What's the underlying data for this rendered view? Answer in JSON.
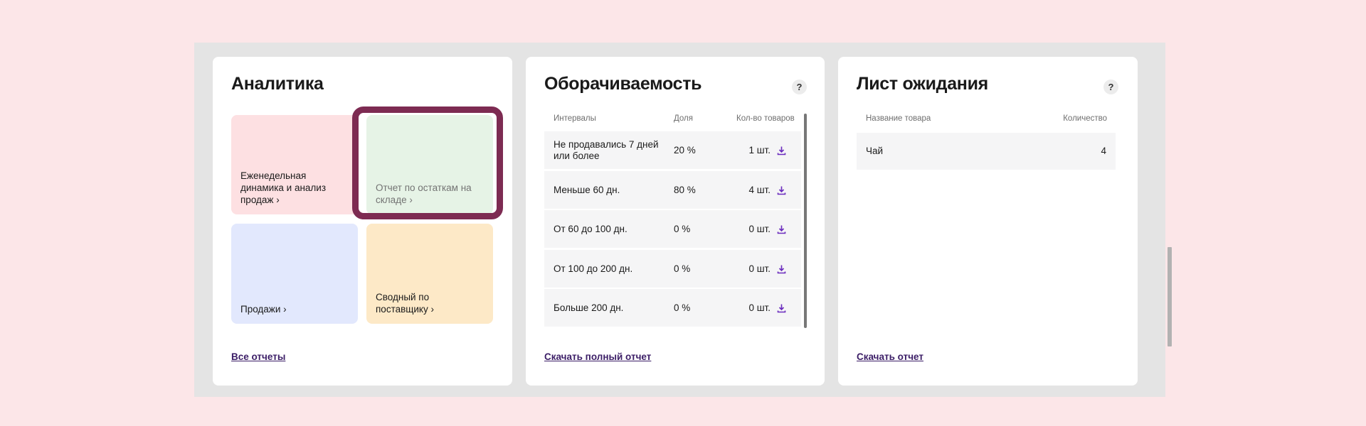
{
  "analytics": {
    "title": "Аналитика",
    "tiles": [
      {
        "label": "Еженедельная динамика и анализ продаж",
        "color": "#fde0e2"
      },
      {
        "label": "Отчет по остаткам на складе",
        "color": "#e6f3e6"
      },
      {
        "label": "Продажи",
        "color": "#e2e8fd"
      },
      {
        "label": "Сводный по поставщику",
        "color": "#fde9c7"
      }
    ],
    "all_reports_link": "Все отчеты"
  },
  "turnover": {
    "title": "Оборачиваемость",
    "help": "?",
    "columns": [
      "Интервалы",
      "Доля",
      "Кол-во товаров"
    ],
    "rows": [
      {
        "interval": "Не продавались 7 дней или более",
        "share": "20 %",
        "count": "1 шт."
      },
      {
        "interval": "Меньше 60 дн.",
        "share": "80 %",
        "count": "4 шт."
      },
      {
        "interval": "От 60 до 100 дн.",
        "share": "0 %",
        "count": "0 шт."
      },
      {
        "interval": "От 100 до 200 дн.",
        "share": "0 %",
        "count": "0 шт."
      },
      {
        "interval": "Больше 200 дн.",
        "share": "0 %",
        "count": "0 шт."
      }
    ],
    "download_link": "Скачать полный отчет"
  },
  "waitlist": {
    "title": "Лист ожидания",
    "help": "?",
    "columns": [
      "Название товара",
      "Количество"
    ],
    "rows": [
      {
        "name": "Чай",
        "qty": "4"
      }
    ],
    "download_link": "Скачать отчет"
  },
  "colors": {
    "accent": "#7d2b52",
    "link": "#3b1d66",
    "download_icon": "#6a2bbd"
  }
}
